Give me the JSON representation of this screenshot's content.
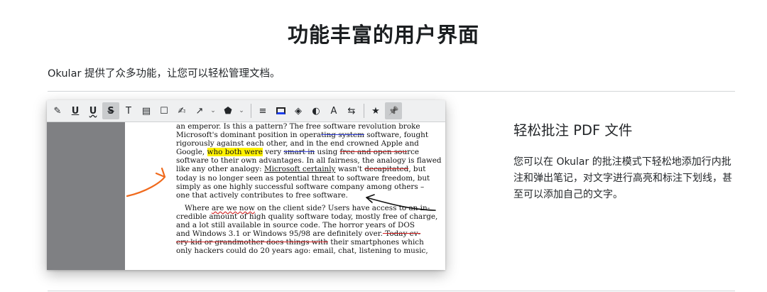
{
  "page": {
    "title": "功能丰富的用户界面",
    "intro": "Okular 提供了众多功能，让您可以轻松管理文档。"
  },
  "feature": {
    "heading": "轻松批注 PDF 文件",
    "description": "您可以在 Okular 的批注模式下轻松地添加行内批注和弹出笔记，对文字进行高亮和标注下划线，甚至可以添加自己的文字。"
  },
  "toolbar": {
    "icons": [
      "highlighter-icon",
      "underline-icon",
      "squiggle-icon",
      "strikeout-icon",
      "typewriter-icon",
      "inline-note-icon",
      "popup-note-icon",
      "freehand-line-icon",
      "arrow-icon",
      "stamp-icon",
      "line-width-icon",
      "color-icon",
      "fill-icon",
      "opacity-icon",
      "font-icon",
      "advanced-settings-icon",
      "favorite-icon",
      "pin-icon"
    ],
    "glyphs": {
      "highlighter": "✎",
      "underline": "U",
      "squiggle": "U",
      "strikeout": "S",
      "typewriter": "T",
      "inline_note": "▤",
      "popup_note": "☐",
      "freehand": "✍",
      "arrow": "↗",
      "stamp": "⬟",
      "line_width": "≡",
      "color": "▭",
      "fill": "◈",
      "opacity": "◐",
      "font": "A",
      "settings": "⇆",
      "favorite": "★",
      "pin": "📌"
    },
    "dropdown_glyph": "⌄"
  },
  "document": {
    "lines": [
      [
        "an emperor.  Is this a pattern?  The free software revolution broke"
      ],
      [
        "Microsoft's dominant position in opera",
        "ting system",
        " software, fought"
      ],
      [
        "rigorously against each other, and in the end crowned Apple and"
      ],
      [
        "Google, ",
        "who both were",
        " very ",
        "smart in",
        " using ",
        "free and open sou",
        "rce"
      ],
      [
        "software to their own advantages.  In all fairness, the analogy is flawed"
      ],
      [
        "like any other analogy: ",
        "Microsoft certainly",
        " wasn't ",
        "decapitated",
        ", but"
      ],
      [
        "today is no longer seen as potential threat to software freedom, but"
      ],
      [
        "simply as one highly successful software company among others –"
      ],
      [
        "one that actively contributes to free software."
      ],
      [
        "Where ",
        "are we now",
        " on the client side?  Users have access to an in-"
      ],
      [
        "credible amount of high quality software today, mostly free of charge,"
      ],
      [
        "and a lot still available in source code.  The horror years of DOS"
      ],
      [
        "and Windows 3.1 or Windows 95/98 are definitely over.",
        " Today ev-"
      ],
      [
        "ery kid or grandmother does things with",
        " their smartphones which"
      ],
      [
        "only hackers could do 20 years ago: email, chat, listening to music,"
      ]
    ]
  },
  "colors": {
    "accent_orange": "#f06a1d",
    "highlight_yellow": "#fff200",
    "strike_red": "#d21f1f",
    "strike_blue": "#2d3bd6",
    "sidebar_gray": "#7f8083",
    "toolbar_bg": "#eff0f1"
  }
}
